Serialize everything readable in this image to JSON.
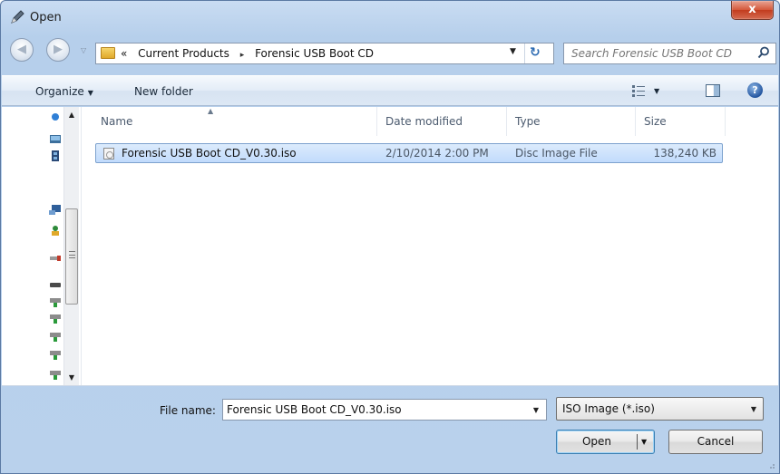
{
  "window": {
    "title": "Open",
    "close_label": "x"
  },
  "nav": {
    "back_icon": "back-arrow-icon",
    "forward_icon": "forward-arrow-icon"
  },
  "address": {
    "prefix": "«",
    "crumbs": [
      "Current Products",
      "Forensic USB Boot CD"
    ],
    "separator": "▸"
  },
  "search": {
    "placeholder": "Search Forensic USB Boot CD"
  },
  "toolbar": {
    "organize": "Organize",
    "new_folder": "New folder",
    "help": "?"
  },
  "columns": {
    "name": "Name",
    "date": "Date modified",
    "type": "Type",
    "size": "Size"
  },
  "files": [
    {
      "name": "Forensic USB Boot CD_V0.30.iso",
      "date": "2/10/2014 2:00 PM",
      "type": "Disc Image File",
      "size": "138,240 KB"
    }
  ],
  "footer": {
    "filename_label": "File name:",
    "filename_value": "Forensic USB Boot CD_V0.30.iso",
    "filter_value": "ISO Image (*.iso)",
    "open_label": "Open",
    "cancel_label": "Cancel"
  },
  "colors": {
    "selection": "#c1dbfc",
    "frame": "#b9d1ec"
  }
}
